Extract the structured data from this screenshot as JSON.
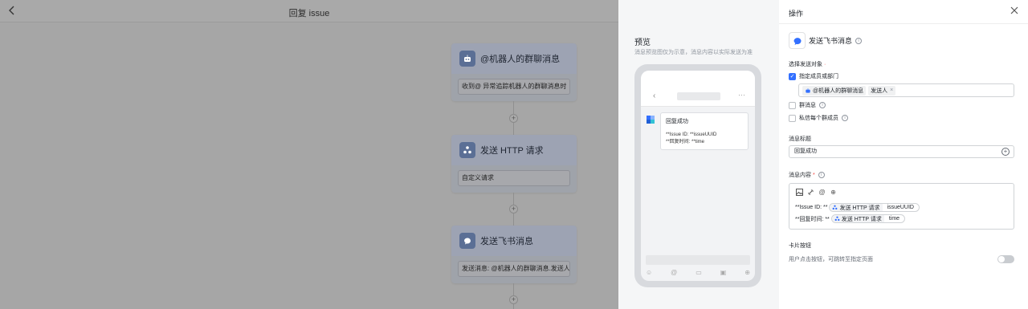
{
  "topbar": {
    "title": "回复 issue",
    "back_icon": "chevron-left-icon"
  },
  "nodes": [
    {
      "title": "@机器人的群聊消息",
      "icon": "robot-icon",
      "field": "收到@ 异常追踪机器人的群聊消息时"
    },
    {
      "title": "发送 HTTP 请求",
      "icon": "http-icon",
      "field": "自定义请求"
    },
    {
      "title": "发送飞书消息",
      "icon": "feishu-message-icon",
      "field": "发送消息: @机器人的群聊消息.发送人"
    }
  ],
  "preview": {
    "title": "预览",
    "subtitle": "消息预览图仅为示意，消息内容以实际发送为准",
    "card": {
      "title": "回复成功",
      "line1": "**Issue ID: **issueUUID",
      "line2": "**回复时间: **time"
    }
  },
  "panel": {
    "title": "操作",
    "action_name": "发送飞书消息",
    "target_label": "选择发送对象",
    "opt_member": "指定成员或部门",
    "member_tag_source": "@机器人的群聊消息",
    "member_tag_field": "发送人",
    "opt_group": "群消息",
    "opt_private": "私信每个群成员",
    "msg_title_label": "消息标题",
    "msg_title_value": "回复成功",
    "msg_content_label": "消息内容",
    "content_line1_prefix": "**Issue ID: **",
    "content_line1_source": "发送 HTTP 请求",
    "content_line1_field": "issueUUID",
    "content_line2_prefix": "**回复时间: **",
    "content_line2_source": "发送 HTTP 请求",
    "content_line2_field": "time",
    "card_button_label": "卡片按钮",
    "card_button_hint": "用户点击按钮，可跳转至指定页面",
    "toggle_on": false
  },
  "colors": {
    "accent": "#3370ff",
    "required": "#f54a45"
  }
}
